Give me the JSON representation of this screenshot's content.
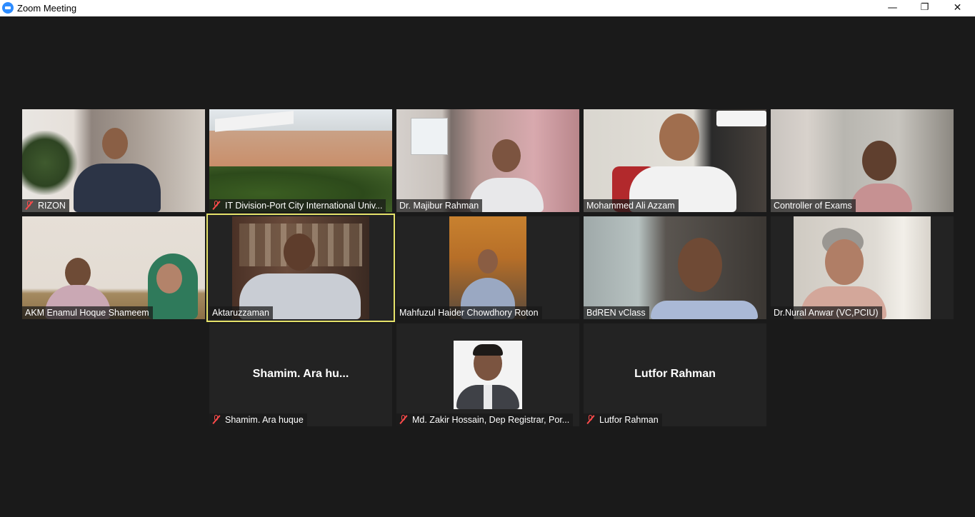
{
  "window": {
    "title": "Zoom Meeting",
    "minimize": "—",
    "restore": "❐",
    "close": "✕"
  },
  "participants": [
    {
      "name": "RIZON",
      "muted": true
    },
    {
      "name": "IT Division-Port City International Univ...",
      "muted": true
    },
    {
      "name": "Dr. Majibur Rahman",
      "muted": false
    },
    {
      "name": "Mohammed Ali Azzam",
      "muted": false
    },
    {
      "name": "Controller of Exams",
      "muted": false
    },
    {
      "name": "AKM Enamul Hoque Shameem",
      "muted": false
    },
    {
      "name": "Aktaruzzaman",
      "muted": false,
      "active_speaker": true
    },
    {
      "name": "Mahfuzul Haider Chowdhory Roton",
      "muted": false
    },
    {
      "name": "BdREN vClass",
      "muted": false
    },
    {
      "name": "Dr.Nural Anwar (VC,PCIU)",
      "muted": false
    },
    {
      "name": "Shamim. Ara huque",
      "muted": true,
      "display_text": "Shamim. Ara hu..."
    },
    {
      "name": "Md. Zakir Hossain, Dep Registrar, Por...",
      "muted": true
    },
    {
      "name": "Lutfor Rahman",
      "muted": true,
      "display_text": "Lutfor Rahman"
    }
  ],
  "colors": {
    "background": "#1a1a1a",
    "tile": "#232323",
    "active_border": "#e6e36a",
    "muted_icon": "#ff4b4b"
  }
}
